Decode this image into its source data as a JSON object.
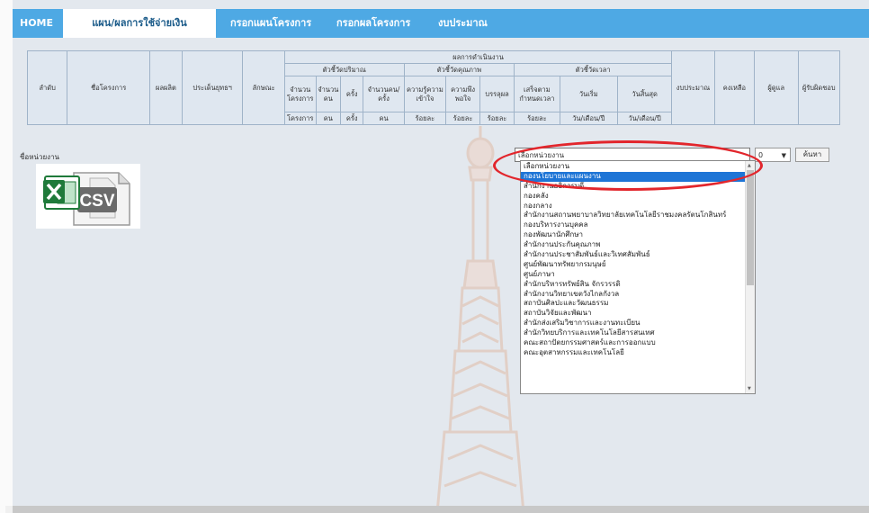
{
  "nav": {
    "tabs": [
      "HOME",
      "แผน/ผลการใช้จ่ายเงิน",
      "กรอกแผนโครงการ",
      "กรอกผลโครงการ",
      "งบประมาณ"
    ]
  },
  "table_header": {
    "row1": {
      "seq": "ลำดับ",
      "name": "ชื่อโครงการ",
      "output": "ผลผลิต",
      "issue": "ประเด็นยุทธฯ",
      "nature": "ลักษณะ",
      "performance": "ผลการดำเนินงาน",
      "budget": "งบประมาณ",
      "remaining": "คงเหลือ",
      "owner": "ผู้ดูแล",
      "contact": "ผู้รับผิดชอบ"
    },
    "groups": {
      "quantity": "ตัวชี้วัดปริมาณ",
      "quality": "ตัวชี้วัดคุณภาพ",
      "time": "ตัวชี้วัดเวลา"
    },
    "sub": [
      "จำนวนโครงการ",
      "จำนวนคน",
      "ครั้ง",
      "จำนวนคน/ครั้ง",
      "ความรู้ความเข้าใจ",
      "ความพึงพอใจ",
      "บรรลุผล",
      "เสร็จตามกำหนดเวลา",
      "วันเริ่ม",
      "วันสิ้นสุด"
    ],
    "units": [
      "โครงการ",
      "คน",
      "ครั้ง",
      "คน",
      "ร้อยละ",
      "ร้อยละ",
      "ร้อยละ",
      "ร้อยละ",
      "วัน/เดือน/ปี",
      "วัน/เดือน/ปี"
    ]
  },
  "org_label": "ชื่อหน่วยงาน",
  "org_select_value": "เลือกหน่วยงาน",
  "year_select_value": "0",
  "search_button": "ค้นหา",
  "csv_label": "CSV",
  "dropdown_options": [
    "เลือกหน่วยงาน",
    "กองนโยบายและแผนงาน",
    "สำนักงานอธิการบดี",
    "กองคลัง",
    "กองกลาง",
    "สำนักงานสถานพยาบาลวิทยาลัยเทคโนโลยีราชมงคลรัตนโกสินทร์",
    "กองบริหารงานบุคคล",
    "กองพัฒนานักศึกษา",
    "สำนักงานประกันคุณภาพ",
    "สำนักงานประชาสัมพันธ์และวิเทศสัมพันธ์",
    "ศูนย์พัฒนาทรัพยากรมนุษย์",
    "ศูนย์ภาษา",
    "สำนักบริหารทรัพย์สิน จักรวรรดิ",
    "สำนักงานวิทยาเขตวังไกลกังวล",
    "สถาบันศิลปะและวัฒนธรรม",
    "สถาบันวิจัยและพัฒนา",
    "สำนักส่งเสริมวิชาการและงานทะเบียน",
    "สำนักวิทยบริการและเทคโนโลยีสารสนเทศ",
    "คณะสถาปัตยกรรมศาสตร์และการออกแบบ",
    "คณะอุตสาหกรรมและเทคโนโลยี"
  ],
  "selected_option_index": 1,
  "colors": {
    "nav": "#4ea9e4",
    "highlight": "#1e75d6",
    "annotation": "#e2262c"
  },
  "icons": [
    "excel-icon",
    "csv-file-icon",
    "scroll-up-icon",
    "scroll-down-icon"
  ]
}
